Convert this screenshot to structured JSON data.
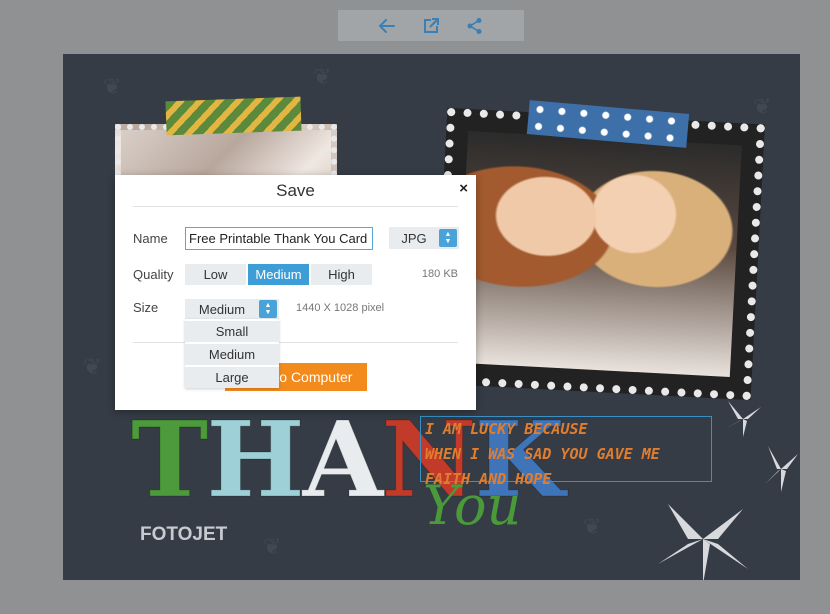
{
  "toolbar": {
    "icons": [
      "arrow-left-icon",
      "open-external-icon",
      "share-icon"
    ],
    "accent": "#3a7fb5"
  },
  "card": {
    "thank_text": [
      "T",
      "H",
      "A",
      "N",
      "K"
    ],
    "thank_colors": [
      "#4c9a3b",
      "#9ed0d8",
      "#e8ecef",
      "#c23b2a",
      "#3f74b8"
    ],
    "you_text": "You",
    "brand": "FOTOJET",
    "quote_lines": [
      "I AM LUCKY BECAUSE",
      "WHEN I WAS SAD YOU GAVE ME",
      "FAITH AND HOPE"
    ]
  },
  "modal": {
    "title": "Save",
    "close_label": "×",
    "name_label": "Name",
    "name_value": "Free Printable Thank You Card",
    "format_value": "JPG",
    "quality_label": "Quality",
    "quality_options": [
      "Low",
      "Medium",
      "High"
    ],
    "quality_selected": "Medium",
    "file_size": "180 KB",
    "size_label": "Size",
    "size_value": "Medium",
    "dimensions": "1440 X 1028 pixel",
    "size_options": [
      "Small",
      "Medium",
      "Large"
    ],
    "save_button": "Save to Computer",
    "accent": "#3d9dd6",
    "save_color": "#f28a1c"
  }
}
